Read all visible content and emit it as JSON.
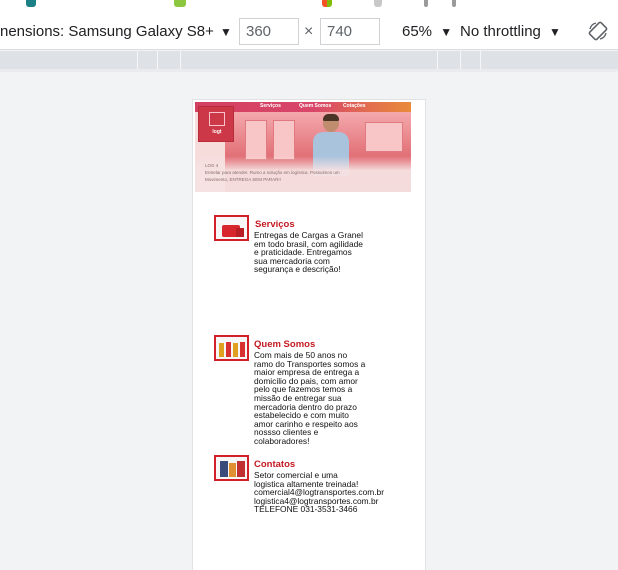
{
  "devtools": {
    "dimensions_label": "nensions: Samsung Galaxy S8+",
    "dropdown_arrow": "▼",
    "width_value": "360",
    "times_sign": "×",
    "height_value": "740",
    "zoom_label": "65%",
    "throttling_label": "No throttling"
  },
  "site": {
    "nav": [
      "Serviços",
      "Quem Somos",
      "Cotações"
    ],
    "logo_text": "logt",
    "hero_caption": [
      "LOG 4",
      "Entrelar para atender. Rumo a solução em logística. Possuimos um",
      "Movimento, ENTREGA SEM PARAR!!"
    ],
    "sections": [
      {
        "title": "Serviços",
        "body": [
          "Entregas de Cargas a Granel",
          "em todo brasil, com agilidade",
          "e praticidade. Entregamos",
          "sua mercadoria com",
          "segurança e descrição!"
        ]
      },
      {
        "title": "Quem Somos",
        "body": [
          "Com mais de 50 anos no",
          "ramo do Transportes somos a",
          "maior empresa de entrega a",
          "domicilio do pais, com amor",
          "pelo que fazemos temos a",
          "missão de entregar sua",
          "mercadoria dentro do prazo",
          "estabelecido e com muito",
          "amor carinho e respeito aos",
          "nossso clientes e",
          "colaboradores!"
        ]
      },
      {
        "title": "Contatos",
        "body": [
          "Setor comercial e uma",
          "logistica altamente treinada!",
          "comercial4@logtransportes.com.br",
          "logistica4@logtransportes.com.br",
          "TELEFONE 031-3531-3466"
        ]
      }
    ]
  },
  "colors": {
    "accent_red": "#c41a22",
    "nav_gradient_start": "#d34060",
    "nav_gradient_end": "#e98b3a"
  }
}
